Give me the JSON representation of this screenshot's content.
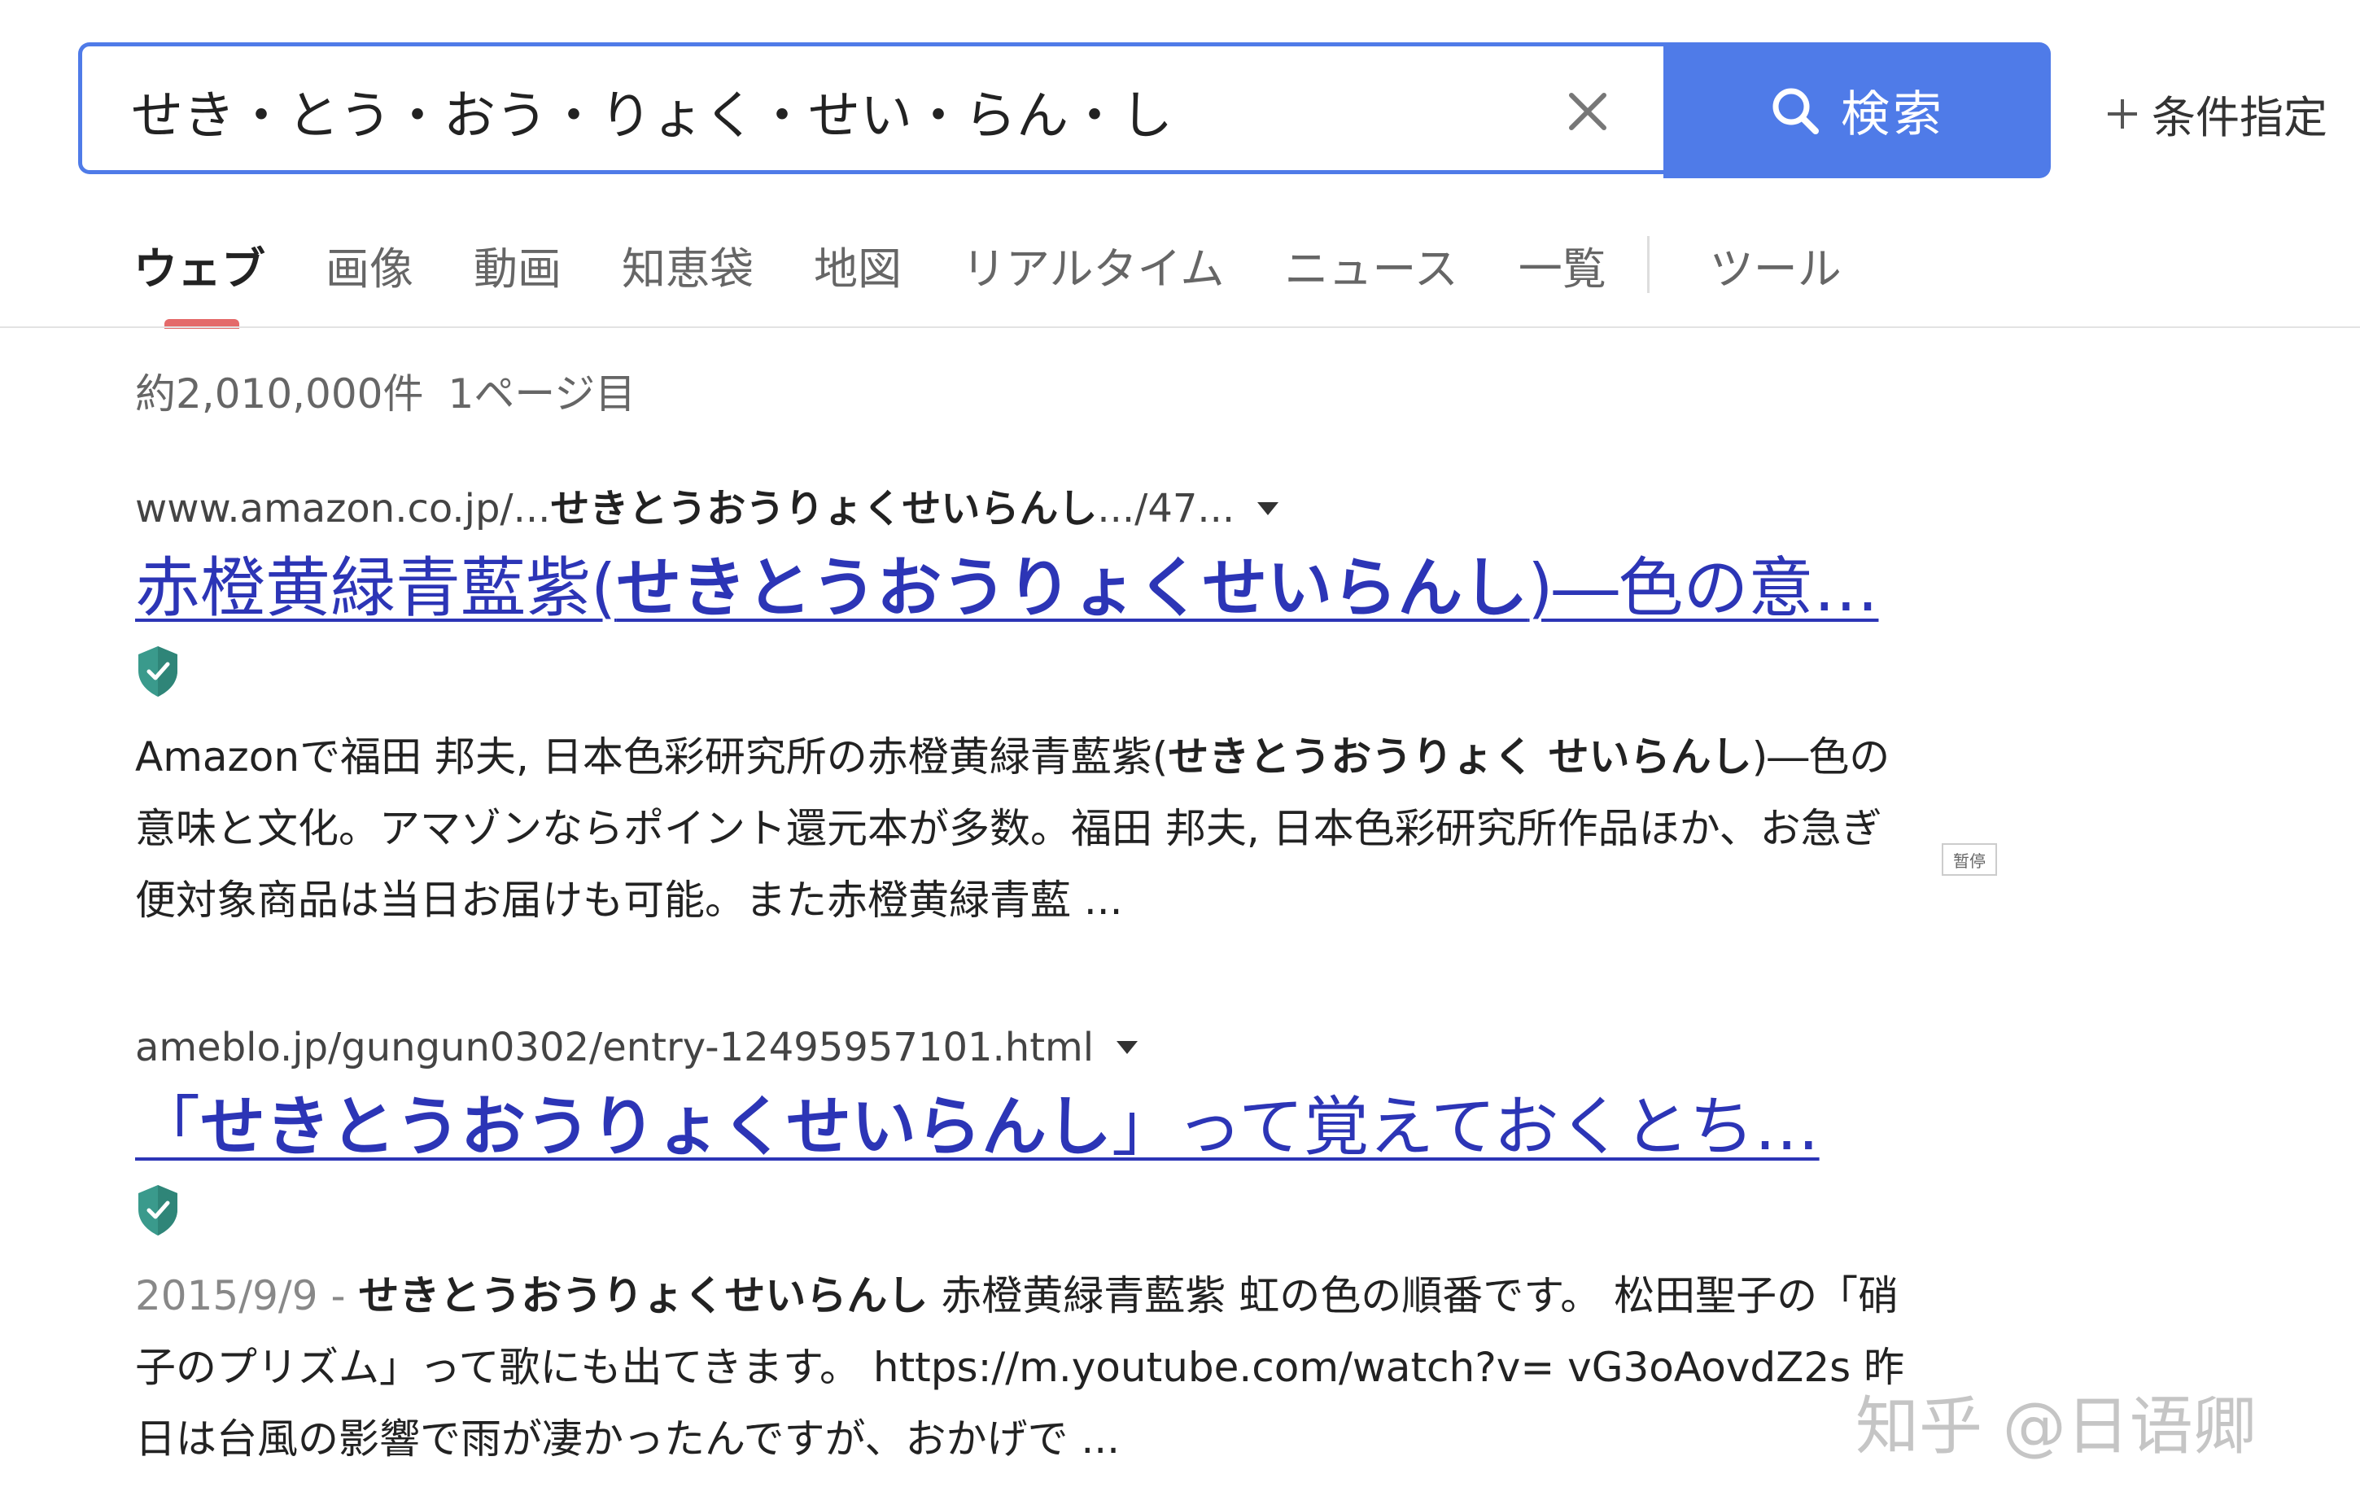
{
  "search": {
    "query": "せき・とう・おう・りょく・せい・らん・し",
    "button_label": "検索",
    "advanced_label": "条件指定"
  },
  "tabs": [
    {
      "label": "ウェブ",
      "active": true
    },
    {
      "label": "画像"
    },
    {
      "label": "動画"
    },
    {
      "label": "知恵袋"
    },
    {
      "label": "地図"
    },
    {
      "label": "リアルタイム"
    },
    {
      "label": "ニュース"
    },
    {
      "label": "一覧"
    },
    {
      "label": "ツール"
    }
  ],
  "results_info": {
    "count": "約2,010,000件",
    "page": "1ページ目"
  },
  "results": [
    {
      "url_prefix": "www.amazon.co.jp/...",
      "url_bold": "せきとうおうりょくせいらんし",
      "url_suffix": ".../47...",
      "title_pre": "赤橙黄緑青藍紫(",
      "title_bold": "せきとうおうりょくせいらんし",
      "title_post": ")―色の意…",
      "snippet_1": "Amazonで福田 邦夫, 日本色彩研究所の赤橙黄緑青藍紫(",
      "snippet_bold": "せきとうおうりょく せいらんし",
      "snippet_2": ")―色の意味と文化。アマゾンならポイント還元本が多数。福田 邦夫, 日本色彩研究所作品ほか、お急ぎ便対象商品は当日お届けも可能。また赤橙黄緑青藍 ..."
    },
    {
      "url_prefix": "ameblo.jp/gungun0302/entry-12495957101.html",
      "title_pre": "「",
      "title_bold": "せきとうおうりょくせいらんし",
      "title_post": "」って覚えておくとち…",
      "date": "2015/9/9",
      "date_sep": " - ",
      "snippet_bold": "せきとうおうりょくせいらんし",
      "snippet_2": " 赤橙黄緑青藍紫 虹の色の順番です。 松田聖子の「硝子のプリズム」って歌にも出てきます。 https://m.youtube.com/watch?v= vG3oAovdZ2s 昨日は台風の影響で雨が凄かったんですが、おかげで ..."
    }
  ],
  "pause_badge": "暂停",
  "watermark": "知乎 @日语卿",
  "colors": {
    "accent": "#4f7be8",
    "link": "#2c35b6",
    "active_tab_indicator": "#e46a6a",
    "verified_shield": "#3a9a8c"
  },
  "icons": {
    "clear": "close-icon",
    "search": "search-icon",
    "advanced": "plus-icon",
    "url_menu": "caret-down-icon",
    "verified": "shield-check-icon"
  }
}
